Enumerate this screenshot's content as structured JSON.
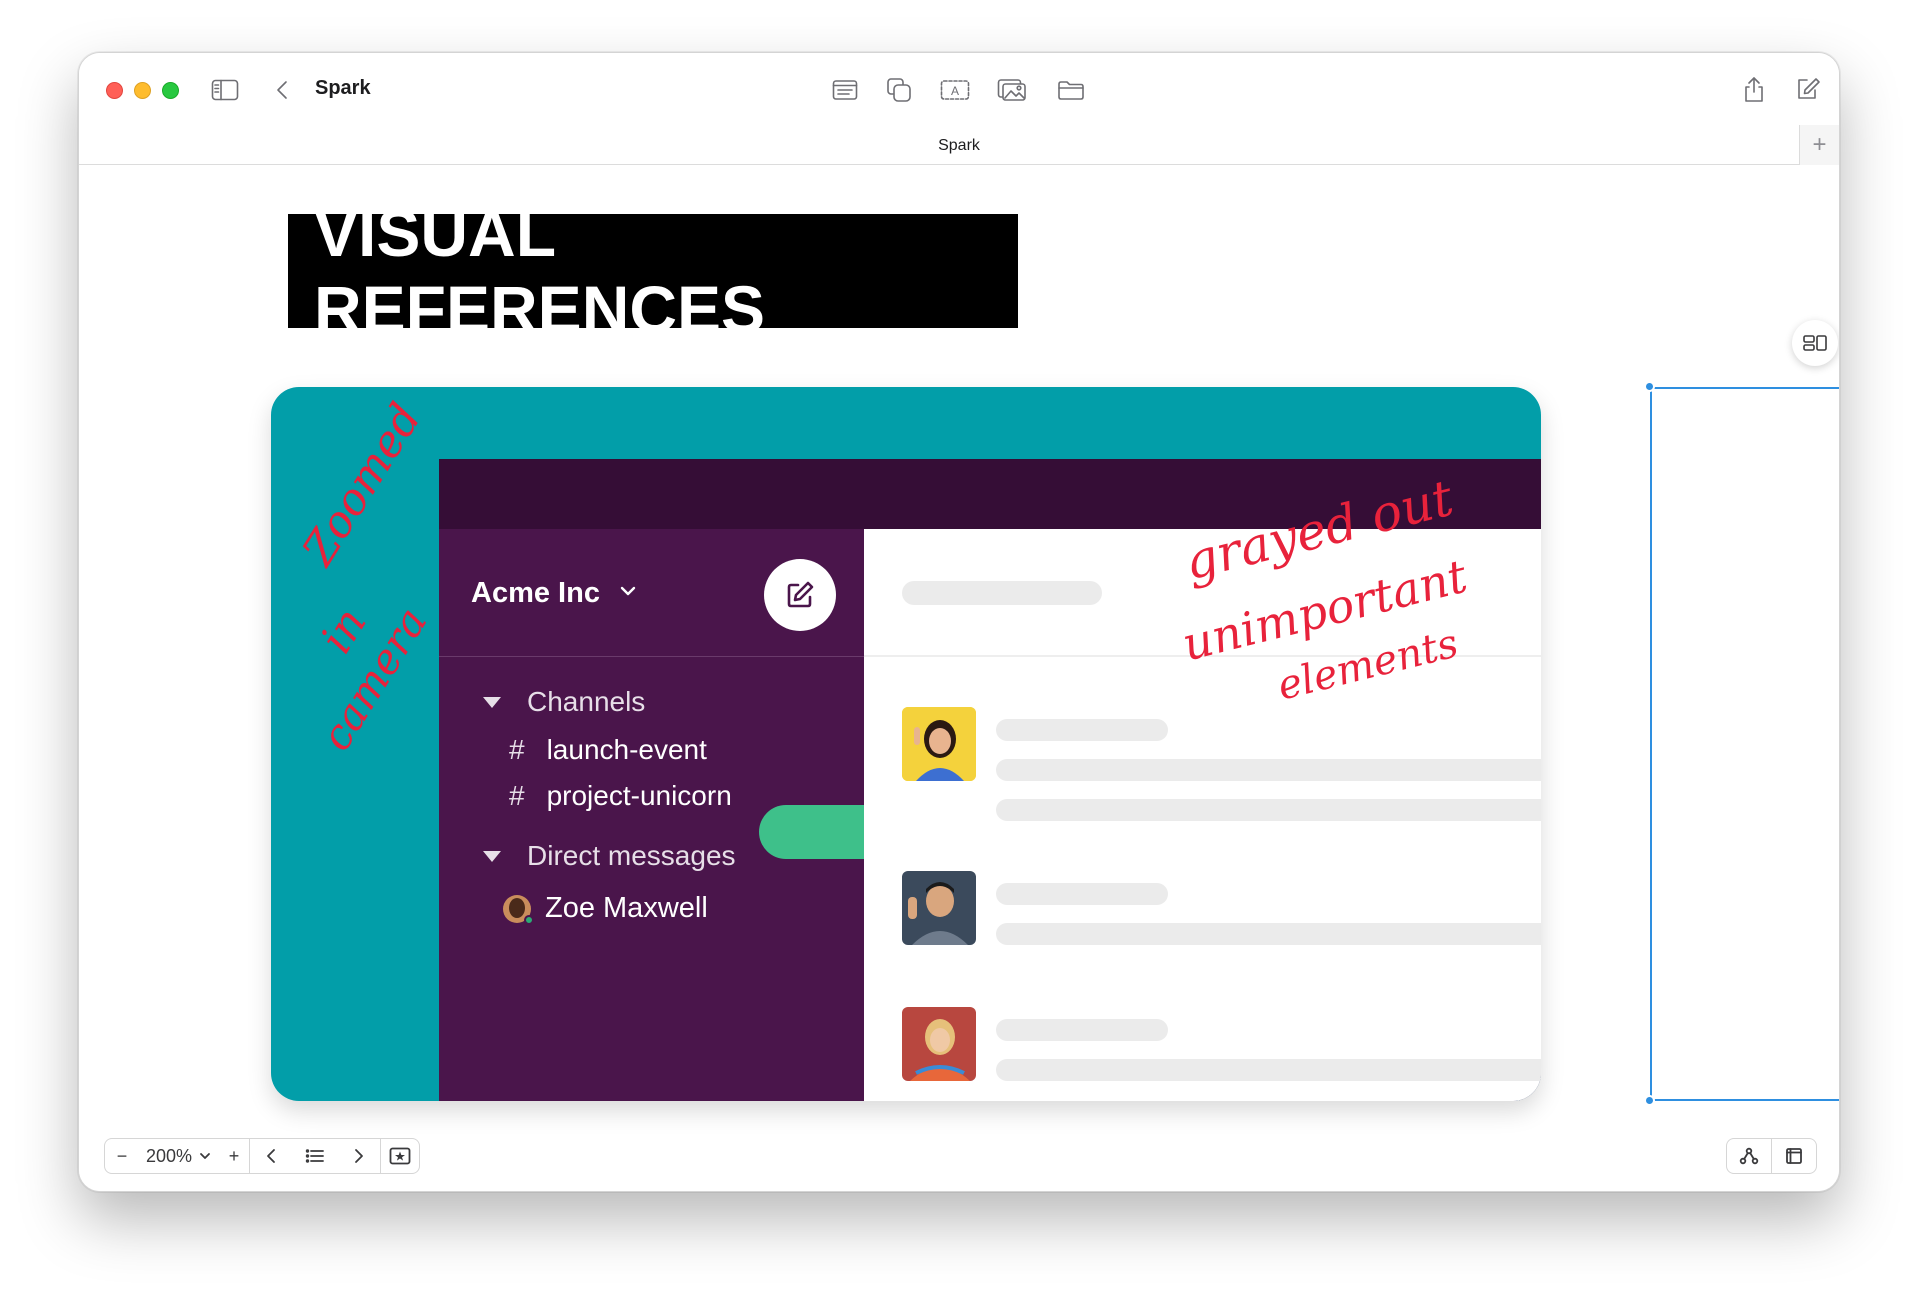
{
  "window": {
    "app_title": "Spark",
    "tab_title": "Spark",
    "tab_add_label": "+"
  },
  "toolbar": {
    "left_icons": [
      "sidebar-toggle-icon",
      "back-chevron-icon"
    ],
    "center_icons": [
      "text-block-icon",
      "shapes-icon",
      "text-box-icon",
      "media-icon",
      "folder-icon"
    ],
    "right_icons": [
      "share-icon",
      "compose-icon"
    ]
  },
  "board": {
    "heading": "VISUAL REFERENCES"
  },
  "mockup": {
    "workspace": "Acme Inc",
    "sections": {
      "channels_label": "Channels",
      "dm_label": "Direct messages"
    },
    "channels": [
      {
        "hash": "#",
        "name": "launch-event"
      },
      {
        "hash": "#",
        "name": "project-unicorn"
      }
    ],
    "dms": [
      {
        "name": "Zoe Maxwell"
      }
    ],
    "colors": {
      "card_bg": "#029ea9",
      "sidebar_bg": "#4a154b",
      "topbar_bg": "#350d36",
      "highlight": "#3ec08a",
      "annotation": "#e8223b"
    }
  },
  "annotations": {
    "left_line1": "Zoomed",
    "left_line2": "in",
    "left_line3": "camera",
    "right_line1": "grayed out",
    "right_line2": "unimportant",
    "right_line3": "elements"
  },
  "zoom": {
    "value": "200%",
    "minus": "−",
    "plus": "+"
  }
}
